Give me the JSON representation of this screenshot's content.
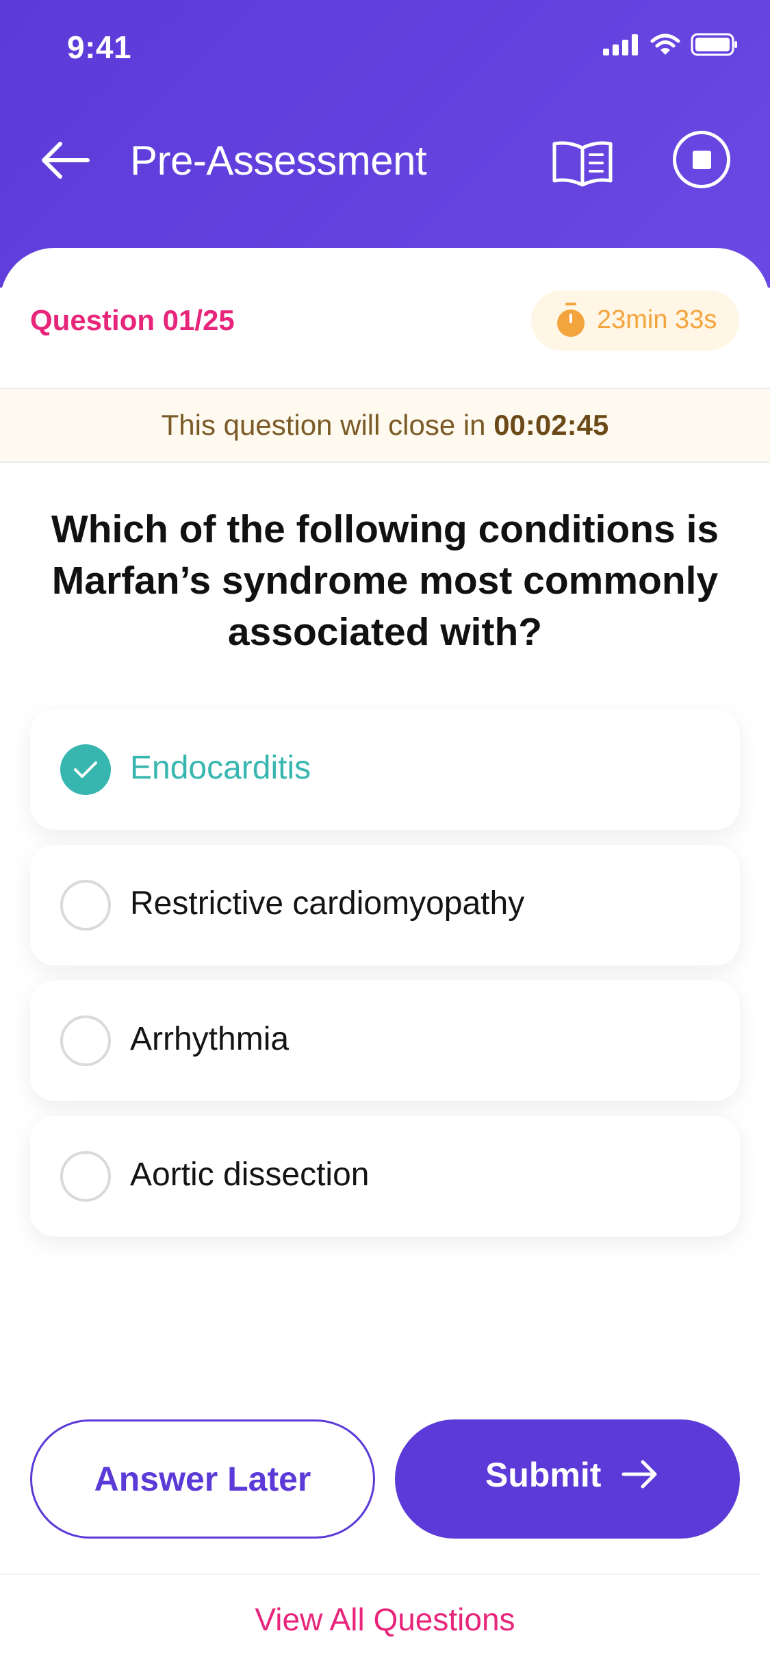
{
  "status_bar": {
    "time": "9:41"
  },
  "nav": {
    "title": "Pre-Assessment"
  },
  "question_header": {
    "count": "Question 01/25",
    "timer": "23min 33s"
  },
  "close_notice": {
    "text": "This question will close in ",
    "time": "00:02:45"
  },
  "question": {
    "text": "Which of the following conditions is Marfan’s syndrome most commonly associated with?"
  },
  "options": [
    {
      "label": "Endocarditis",
      "selected": true
    },
    {
      "label": "Restrictive cardiomyopathy",
      "selected": false
    },
    {
      "label": "Arrhythmia",
      "selected": false
    },
    {
      "label": "Aortic dissection",
      "selected": false
    }
  ],
  "actions": {
    "answer_later": "Answer Later",
    "submit": "Submit"
  },
  "footer": {
    "view_all": "View All Questions"
  },
  "colors": {
    "primary": "#5b3ad8",
    "accent": "#e7257a",
    "selected": "#36b6ae",
    "timer": "#f4a43c"
  }
}
